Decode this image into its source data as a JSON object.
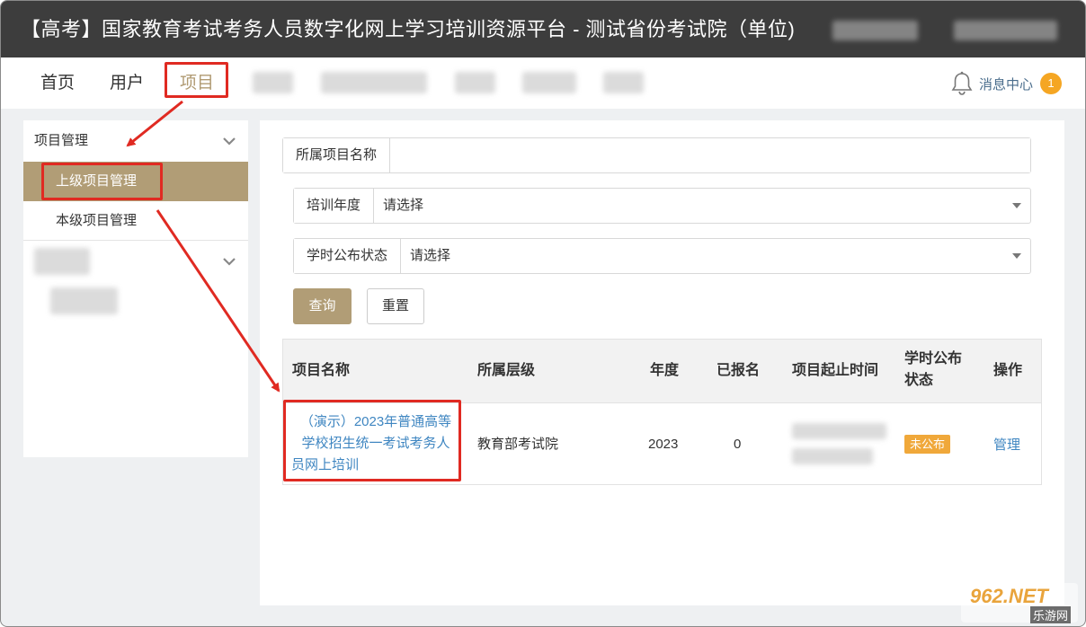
{
  "titlebar": {
    "title": "【高考】国家教育考试考务人员数字化网上学习培训资源平台 - 测试省份考试院（单位)"
  },
  "nav": {
    "items": [
      "首页",
      "用户",
      "项目"
    ],
    "active": "项目",
    "message_center": "消息中心",
    "message_count": "1"
  },
  "sidebar": {
    "group_title": "项目管理",
    "items": [
      "上级项目管理",
      "本级项目管理"
    ],
    "active": "上级项目管理"
  },
  "filters": {
    "project_name_label": "所属项目名称",
    "project_name_value": "",
    "year_label": "培训年度",
    "year_value": "请选择",
    "status_label": "学时公布状态",
    "status_value": "请选择",
    "query_button": "查询",
    "reset_button": "重置"
  },
  "table": {
    "headers": [
      "项目名称",
      "所属层级",
      "年度",
      "已报名",
      "项目起止时间",
      "学时公布\n状态",
      "操作"
    ],
    "header_status_line1": "学时公布",
    "header_status_line2": "状态",
    "rows": [
      {
        "name_line1": "（演示）2023年普通高等",
        "name_line2": "学校招生统一考试考务人",
        "name_line3": "员网上培训",
        "level": "教育部考试院",
        "year": "2023",
        "enrolled": "0",
        "status": "未公布",
        "action": "管理"
      }
    ]
  },
  "watermark": {
    "text": "962.NET",
    "sub": "乐游网"
  },
  "colors": {
    "accent": "#b19d76",
    "titlebar": "#3d3d3d",
    "link": "#3f86c1",
    "badge": "#f5a623",
    "annotation": "#e02a22"
  }
}
